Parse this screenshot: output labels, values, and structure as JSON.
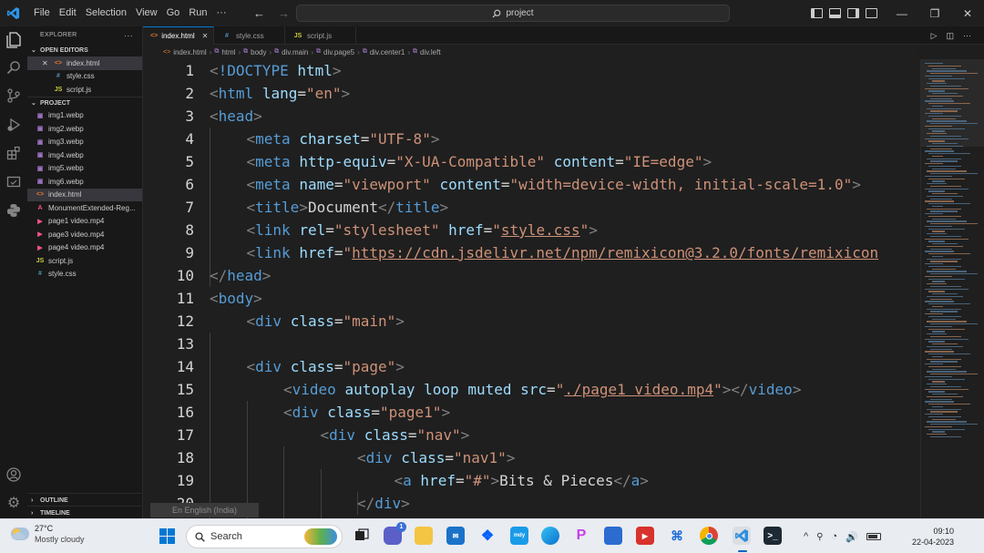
{
  "window": {
    "menu": [
      "File",
      "Edit",
      "Selection",
      "View",
      "Go",
      "Run",
      "···"
    ],
    "search_text": "project"
  },
  "sidebar": {
    "title": "EXPLORER",
    "more": "···",
    "open_editors_title": "OPEN EDITORS",
    "open_editors": [
      {
        "name": "index.html",
        "icon": "html-file-icon",
        "type": "html",
        "close": "✕"
      },
      {
        "name": "style.css",
        "icon": "css-file-icon",
        "type": "css"
      },
      {
        "name": "script.js",
        "icon": "js-file-icon",
        "type": "js"
      }
    ],
    "project_title": "PROJECT",
    "files": [
      {
        "name": "img1.webp",
        "type": "img"
      },
      {
        "name": "img2.webp",
        "type": "img"
      },
      {
        "name": "img3.webp",
        "type": "img"
      },
      {
        "name": "img4.webp",
        "type": "img"
      },
      {
        "name": "img5.webp",
        "type": "img"
      },
      {
        "name": "img6.webp",
        "type": "img"
      },
      {
        "name": "index.html",
        "type": "html"
      },
      {
        "name": "MonumentExtended-Reg...",
        "type": "font"
      },
      {
        "name": "page1 video.mp4",
        "type": "vid"
      },
      {
        "name": "page3 video.mp4",
        "type": "vid"
      },
      {
        "name": "page4 video.mp4",
        "type": "vid"
      },
      {
        "name": "script.js",
        "type": "js"
      },
      {
        "name": "style.css",
        "type": "css"
      }
    ],
    "outline_title": "OUTLINE",
    "timeline_title": "TIMELINE"
  },
  "tabs": [
    {
      "label": "index.html",
      "type": "html",
      "active": true,
      "close": "✕"
    },
    {
      "label": "style.css",
      "type": "css",
      "active": false
    },
    {
      "label": "script.js",
      "type": "js",
      "active": false
    }
  ],
  "breadcrumb": [
    "index.html",
    "html",
    "body",
    "div.main",
    "div.page5",
    "div.center1",
    "div.left"
  ],
  "editor": {
    "lines": [
      {
        "n": "1",
        "indent": 0,
        "tokens": [
          [
            "punc",
            "<"
          ],
          [
            "tag",
            "!DOCTYPE"
          ],
          [
            "text",
            " "
          ],
          [
            "attr",
            "html"
          ],
          [
            "punc",
            ">"
          ]
        ]
      },
      {
        "n": "2",
        "indent": 0,
        "tokens": [
          [
            "punc",
            "<"
          ],
          [
            "tag",
            "html"
          ],
          [
            "text",
            " "
          ],
          [
            "attr",
            "lang"
          ],
          [
            "text",
            "="
          ],
          [
            "str",
            "\"en\""
          ],
          [
            "punc",
            ">"
          ]
        ]
      },
      {
        "n": "3",
        "indent": 0,
        "tokens": [
          [
            "punc",
            "<"
          ],
          [
            "tag",
            "head"
          ],
          [
            "punc",
            ">"
          ]
        ]
      },
      {
        "n": "4",
        "indent": 1,
        "tokens": [
          [
            "punc",
            "<"
          ],
          [
            "tag",
            "meta"
          ],
          [
            "text",
            " "
          ],
          [
            "attr",
            "charset"
          ],
          [
            "text",
            "="
          ],
          [
            "str",
            "\"UTF-8\""
          ],
          [
            "punc",
            ">"
          ]
        ]
      },
      {
        "n": "5",
        "indent": 1,
        "tokens": [
          [
            "punc",
            "<"
          ],
          [
            "tag",
            "meta"
          ],
          [
            "text",
            " "
          ],
          [
            "attr",
            "http-equiv"
          ],
          [
            "text",
            "="
          ],
          [
            "str",
            "\"X-UA-Compatible\""
          ],
          [
            "text",
            " "
          ],
          [
            "attr",
            "content"
          ],
          [
            "text",
            "="
          ],
          [
            "str",
            "\"IE=edge\""
          ],
          [
            "punc",
            ">"
          ]
        ]
      },
      {
        "n": "6",
        "indent": 1,
        "tokens": [
          [
            "punc",
            "<"
          ],
          [
            "tag",
            "meta"
          ],
          [
            "text",
            " "
          ],
          [
            "attr",
            "name"
          ],
          [
            "text",
            "="
          ],
          [
            "str",
            "\"viewport\""
          ],
          [
            "text",
            " "
          ],
          [
            "attr",
            "content"
          ],
          [
            "text",
            "="
          ],
          [
            "str",
            "\"width=device-width, initial-scale=1.0\""
          ],
          [
            "punc",
            ">"
          ]
        ]
      },
      {
        "n": "7",
        "indent": 1,
        "tokens": [
          [
            "punc",
            "<"
          ],
          [
            "tag",
            "title"
          ],
          [
            "punc",
            ">"
          ],
          [
            "text",
            "Document"
          ],
          [
            "punc",
            "</"
          ],
          [
            "tag",
            "title"
          ],
          [
            "punc",
            ">"
          ]
        ]
      },
      {
        "n": "8",
        "indent": 1,
        "tokens": [
          [
            "punc",
            "<"
          ],
          [
            "tag",
            "link"
          ],
          [
            "text",
            " "
          ],
          [
            "attr",
            "rel"
          ],
          [
            "text",
            "="
          ],
          [
            "str",
            "\"stylesheet\""
          ],
          [
            "text",
            " "
          ],
          [
            "attr",
            "href"
          ],
          [
            "text",
            "="
          ],
          [
            "str",
            "\""
          ],
          [
            "link",
            "style.css"
          ],
          [
            "str",
            "\""
          ],
          [
            "punc",
            ">"
          ]
        ]
      },
      {
        "n": "9",
        "indent": 1,
        "tokens": [
          [
            "punc",
            "<"
          ],
          [
            "tag",
            "link"
          ],
          [
            "text",
            " "
          ],
          [
            "attr",
            "href"
          ],
          [
            "text",
            "="
          ],
          [
            "str",
            "\""
          ],
          [
            "link",
            "https://cdn.jsdelivr.net/npm/remixicon@3.2.0/fonts/remixicon"
          ]
        ]
      },
      {
        "n": "10",
        "indent": 0,
        "tokens": [
          [
            "punc",
            "</"
          ],
          [
            "tag",
            "head"
          ],
          [
            "punc",
            ">"
          ]
        ]
      },
      {
        "n": "11",
        "indent": 0,
        "tokens": [
          [
            "punc",
            "<"
          ],
          [
            "tag",
            "body"
          ],
          [
            "punc",
            ">"
          ]
        ]
      },
      {
        "n": "12",
        "indent": 1,
        "tokens": [
          [
            "punc",
            "<"
          ],
          [
            "tag",
            "div"
          ],
          [
            "text",
            " "
          ],
          [
            "attr",
            "class"
          ],
          [
            "text",
            "="
          ],
          [
            "str",
            "\"main\""
          ],
          [
            "punc",
            ">"
          ]
        ]
      },
      {
        "n": "13",
        "indent": 0,
        "tokens": []
      },
      {
        "n": "14",
        "indent": 1,
        "tokens": [
          [
            "punc",
            "<"
          ],
          [
            "tag",
            "div"
          ],
          [
            "text",
            " "
          ],
          [
            "attr",
            "class"
          ],
          [
            "text",
            "="
          ],
          [
            "str",
            "\"page\""
          ],
          [
            "punc",
            ">"
          ]
        ]
      },
      {
        "n": "15",
        "indent": 2,
        "tokens": [
          [
            "punc",
            "<"
          ],
          [
            "tag",
            "video"
          ],
          [
            "text",
            " "
          ],
          [
            "attr",
            "autoplay"
          ],
          [
            "text",
            " "
          ],
          [
            "attr",
            "loop"
          ],
          [
            "text",
            " "
          ],
          [
            "attr",
            "muted"
          ],
          [
            "text",
            " "
          ],
          [
            "attr",
            "src"
          ],
          [
            "text",
            "="
          ],
          [
            "str",
            "\""
          ],
          [
            "link",
            "./page1 video.mp4"
          ],
          [
            "str",
            "\""
          ],
          [
            "punc",
            "></"
          ],
          [
            "tag",
            "video"
          ],
          [
            "punc",
            ">"
          ]
        ]
      },
      {
        "n": "16",
        "indent": 2,
        "tokens": [
          [
            "punc",
            "<"
          ],
          [
            "tag",
            "div"
          ],
          [
            "text",
            " "
          ],
          [
            "attr",
            "class"
          ],
          [
            "text",
            "="
          ],
          [
            "str",
            "\"page1\""
          ],
          [
            "punc",
            ">"
          ]
        ]
      },
      {
        "n": "17",
        "indent": 3,
        "tokens": [
          [
            "punc",
            "<"
          ],
          [
            "tag",
            "div"
          ],
          [
            "text",
            " "
          ],
          [
            "attr",
            "class"
          ],
          [
            "text",
            "="
          ],
          [
            "str",
            "\"nav\""
          ],
          [
            "punc",
            ">"
          ]
        ]
      },
      {
        "n": "18",
        "indent": 4,
        "tokens": [
          [
            "punc",
            "<"
          ],
          [
            "tag",
            "div"
          ],
          [
            "text",
            " "
          ],
          [
            "attr",
            "class"
          ],
          [
            "text",
            "="
          ],
          [
            "str",
            "\"nav1\""
          ],
          [
            "punc",
            ">"
          ]
        ]
      },
      {
        "n": "19",
        "indent": 5,
        "tokens": [
          [
            "punc",
            "<"
          ],
          [
            "tag",
            "a"
          ],
          [
            "text",
            " "
          ],
          [
            "attr",
            "href"
          ],
          [
            "text",
            "="
          ],
          [
            "str",
            "\"#\""
          ],
          [
            "punc",
            ">"
          ],
          [
            "text",
            "Bits & Pieces"
          ],
          [
            "punc",
            "</"
          ],
          [
            "tag",
            "a"
          ],
          [
            "punc",
            ">"
          ]
        ]
      },
      {
        "n": "20",
        "indent": 4,
        "tokens": [
          [
            "punc",
            "</"
          ],
          [
            "tag",
            "div"
          ],
          [
            "punc",
            ">"
          ]
        ]
      }
    ]
  },
  "language_tooltip": "En English (India)",
  "taskbar": {
    "weather_temp": "27°C",
    "weather_desc": "Mostly cloudy",
    "search_placeholder": "Search",
    "time": "09:10",
    "date": "22-04-2023",
    "teams_badge": "1"
  }
}
